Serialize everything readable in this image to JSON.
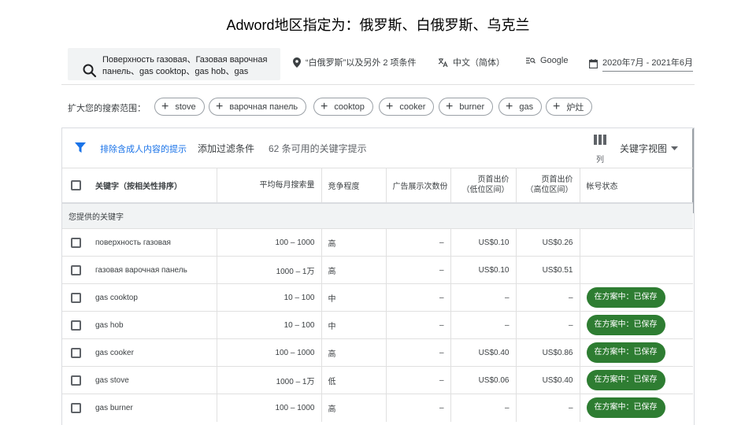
{
  "slide": {
    "title": "Adword地区指定为：俄罗斯、白俄罗斯、乌克兰"
  },
  "query": {
    "line1": "Поверхность газовая、Газовая варочная",
    "line2": "панель、gas cooktop、gas hob、gas"
  },
  "location": "“白俄罗斯”以及另外 2 项条件",
  "language": "中文（简体）",
  "network": "Google",
  "date_range": "2020年7月 - 2021年6月",
  "broaden": {
    "label": "扩大您的搜索范围：",
    "chips": [
      "stove",
      "варочная панель",
      "cooktop",
      "cooker",
      "burner",
      "gas",
      "炉灶"
    ]
  },
  "toolbar": {
    "exclude_adult": "排除含成人内容的提示",
    "add_filter": "添加过滤条件",
    "count": "62 条可用的关键字提示",
    "columns": "列",
    "keyword_view": "关键字视图"
  },
  "table": {
    "headers": {
      "keyword": "关键字（按相关性排序）",
      "avg_searches": "平均每月搜索量",
      "competition": "竞争程度",
      "impression_share": "广告展示次数份",
      "bid_low": "页首出价\n（低位区间）",
      "bid_high": "页首出价\n（高位区间）",
      "status": "帐号状态"
    },
    "group_label": "您提供的关键字",
    "rows": [
      {
        "keyword": "поверхность газовая",
        "searches": "100 – 1000",
        "competition": "高",
        "share": "–",
        "low": "US$0.10",
        "high": "US$0.26",
        "status": ""
      },
      {
        "keyword": "газовая варочная панель",
        "searches": "1000 – 1万",
        "competition": "高",
        "share": "–",
        "low": "US$0.10",
        "high": "US$0.51",
        "status": ""
      },
      {
        "keyword": "gas cooktop",
        "searches": "10 – 100",
        "competition": "中",
        "share": "–",
        "low": "–",
        "high": "–",
        "status": "在方案中：已保存"
      },
      {
        "keyword": "gas hob",
        "searches": "10 – 100",
        "competition": "中",
        "share": "–",
        "low": "–",
        "high": "–",
        "status": "在方案中：已保存"
      },
      {
        "keyword": "gas cooker",
        "searches": "100 – 1000",
        "competition": "高",
        "share": "–",
        "low": "US$0.40",
        "high": "US$0.86",
        "status": "在方案中：已保存"
      },
      {
        "keyword": "gas stove",
        "searches": "1000 – 1万",
        "competition": "低",
        "share": "–",
        "low": "US$0.06",
        "high": "US$0.40",
        "status": "在方案中：已保存"
      },
      {
        "keyword": "gas burner",
        "searches": "100 – 1000",
        "competition": "高",
        "share": "–",
        "low": "–",
        "high": "–",
        "status": "在方案中：已保存"
      }
    ]
  },
  "colors": {
    "accent": "#1a73e8",
    "status_green": "#2e7d32"
  }
}
